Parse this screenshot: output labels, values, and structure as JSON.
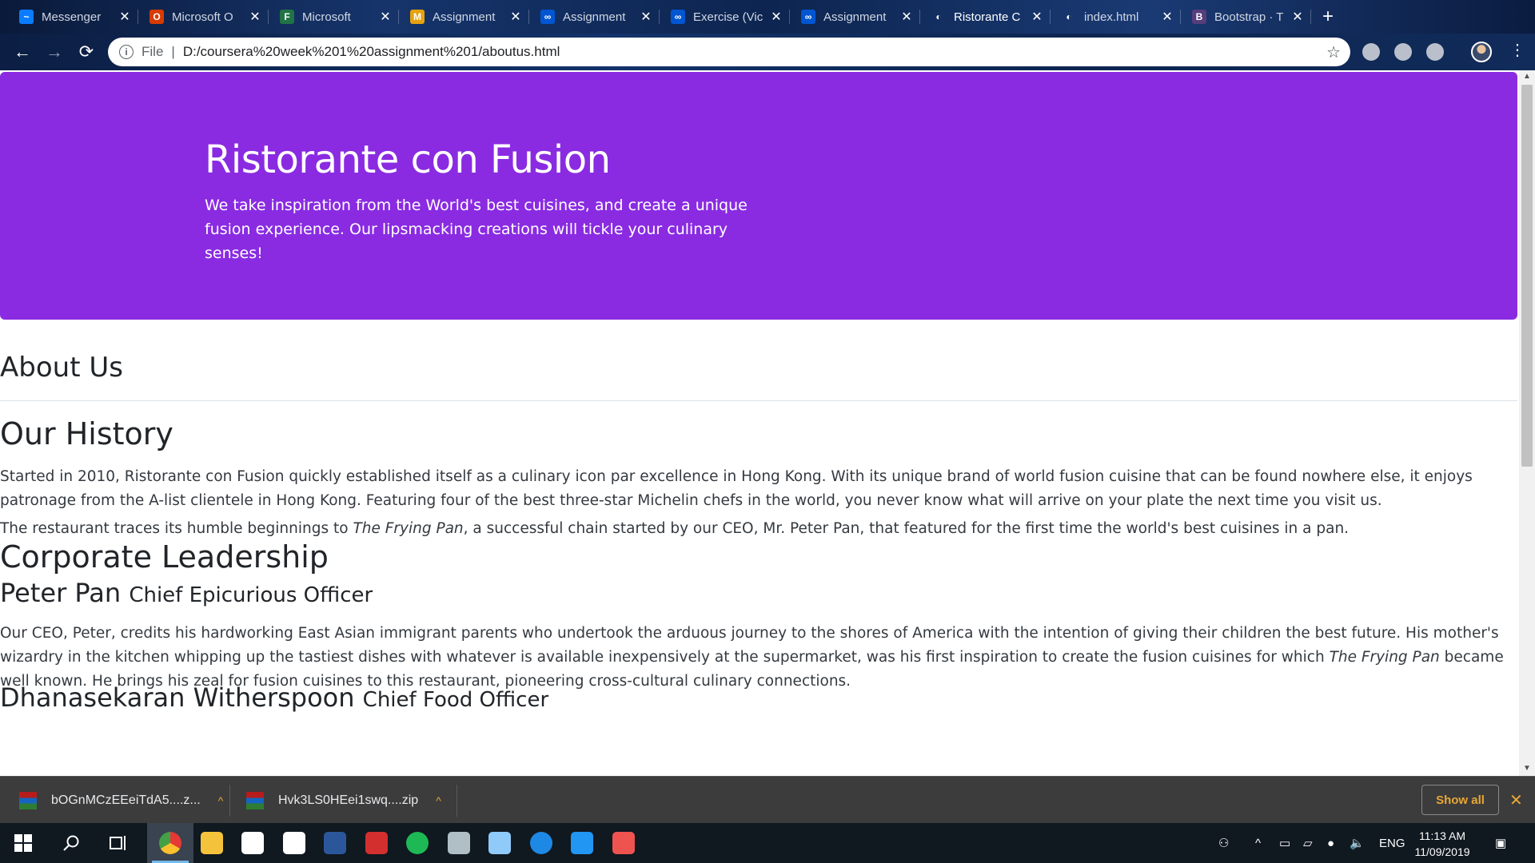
{
  "browser": {
    "tabs": [
      {
        "title": "Messenger",
        "fav_color": "#0a7cff",
        "fav_glyph": "~"
      },
      {
        "title": "Microsoft O",
        "fav_color": "#d83b01",
        "fav_glyph": "O"
      },
      {
        "title": "Microsoft",
        "fav_color": "#217346",
        "fav_glyph": "F"
      },
      {
        "title": "Assignment",
        "fav_color": "#e6a20f",
        "fav_glyph": "M"
      },
      {
        "title": "Assignment",
        "fav_color": "#0056d2",
        "fav_glyph": "∞"
      },
      {
        "title": "Exercise (Vic",
        "fav_color": "#0056d2",
        "fav_glyph": "∞"
      },
      {
        "title": "Assignment",
        "fav_color": "#0056d2",
        "fav_glyph": "∞"
      },
      {
        "title": "Ristorante C",
        "fav_color": "#ffffff",
        "fav_glyph": "◐",
        "active": true
      },
      {
        "title": "index.html",
        "fav_color": "#ffffff",
        "fav_glyph": "◐"
      },
      {
        "title": "Bootstrap · T",
        "fav_color": "#563d7c",
        "fav_glyph": "B"
      }
    ],
    "new_tab_label": "+",
    "address": {
      "scheme_label": "File",
      "url": "D:/coursera%20week%201%20assignment%201/aboutus.html"
    },
    "nav": {
      "back": "←",
      "forward": "→",
      "reload": "⟳"
    },
    "star": "☆",
    "menu": "⋮"
  },
  "page": {
    "jumbotron": {
      "title": "Ristorante con Fusion",
      "tagline": "We take inspiration from the World's best cuisines, and create a unique fusion experience. Our lipsmacking creations will tickle your culinary senses!",
      "background": "#8a2be2"
    },
    "about_heading": "About Us",
    "history": {
      "heading": "Our History",
      "para1": "Started in 2010, Ristorante con Fusion quickly established itself as a culinary icon par excellence in Hong Kong. With its unique brand of world fusion cuisine that can be found nowhere else, it enjoys patronage from the A-list clientele in Hong Kong. Featuring four of the best three-star Michelin chefs in the world, you never know what will arrive on your plate the next time you visit us.",
      "para2_before": "The restaurant traces its humble beginnings to ",
      "para2_italic": "The Frying Pan",
      "para2_after": ", a successful chain started by our CEO, Mr. Peter Pan, that featured for the first time the world's best cuisines in a pan."
    },
    "leadership": {
      "heading": "Corporate Leadership",
      "leaders": [
        {
          "name": "Peter Pan",
          "title": "Chief Epicurious Officer",
          "bio_before": "Our CEO, Peter, credits his hardworking East Asian immigrant parents who undertook the arduous journey to the shores of America with the intention of giving their children the best future. His mother's wizardry in the kitchen whipping up the tastiest dishes with whatever is available inexpensively at the supermarket, was his first inspiration to create the fusion cuisines for which ",
          "bio_italic": "The Frying Pan",
          "bio_after": " became well known. He brings his zeal for fusion cuisines to this restaurant, pioneering cross-cultural culinary connections."
        },
        {
          "name": "Dhanasekaran Witherspoon",
          "title": "Chief Food Officer"
        }
      ]
    }
  },
  "downloads": {
    "items": [
      "bOGnMCzEEeiTdA5....z...",
      "Hvk3LS0HEei1swq....zip"
    ],
    "show_all": "Show all",
    "close": "✕"
  },
  "taskbar": {
    "clock_time": "11:13 AM",
    "clock_date": "11/09/2019",
    "language": "ENG",
    "apps": [
      {
        "name": "chrome",
        "color": "#e53935",
        "active": true
      },
      {
        "name": "file-explorer",
        "color": "#f5c33b"
      },
      {
        "name": "store",
        "color": "#ffffff"
      },
      {
        "name": "mail",
        "color": "#ffffff"
      },
      {
        "name": "word",
        "color": "#2b579a"
      },
      {
        "name": "red-app",
        "color": "#d32f2f"
      },
      {
        "name": "spotify",
        "color": "#1db954"
      },
      {
        "name": "record-app",
        "color": "#b0bec5"
      },
      {
        "name": "notepad-app",
        "color": "#90caf9"
      },
      {
        "name": "maps",
        "color": "#1e88e5"
      },
      {
        "name": "vscode",
        "color": "#2196f3"
      },
      {
        "name": "snipping-tool",
        "color": "#ef5350"
      }
    ]
  }
}
